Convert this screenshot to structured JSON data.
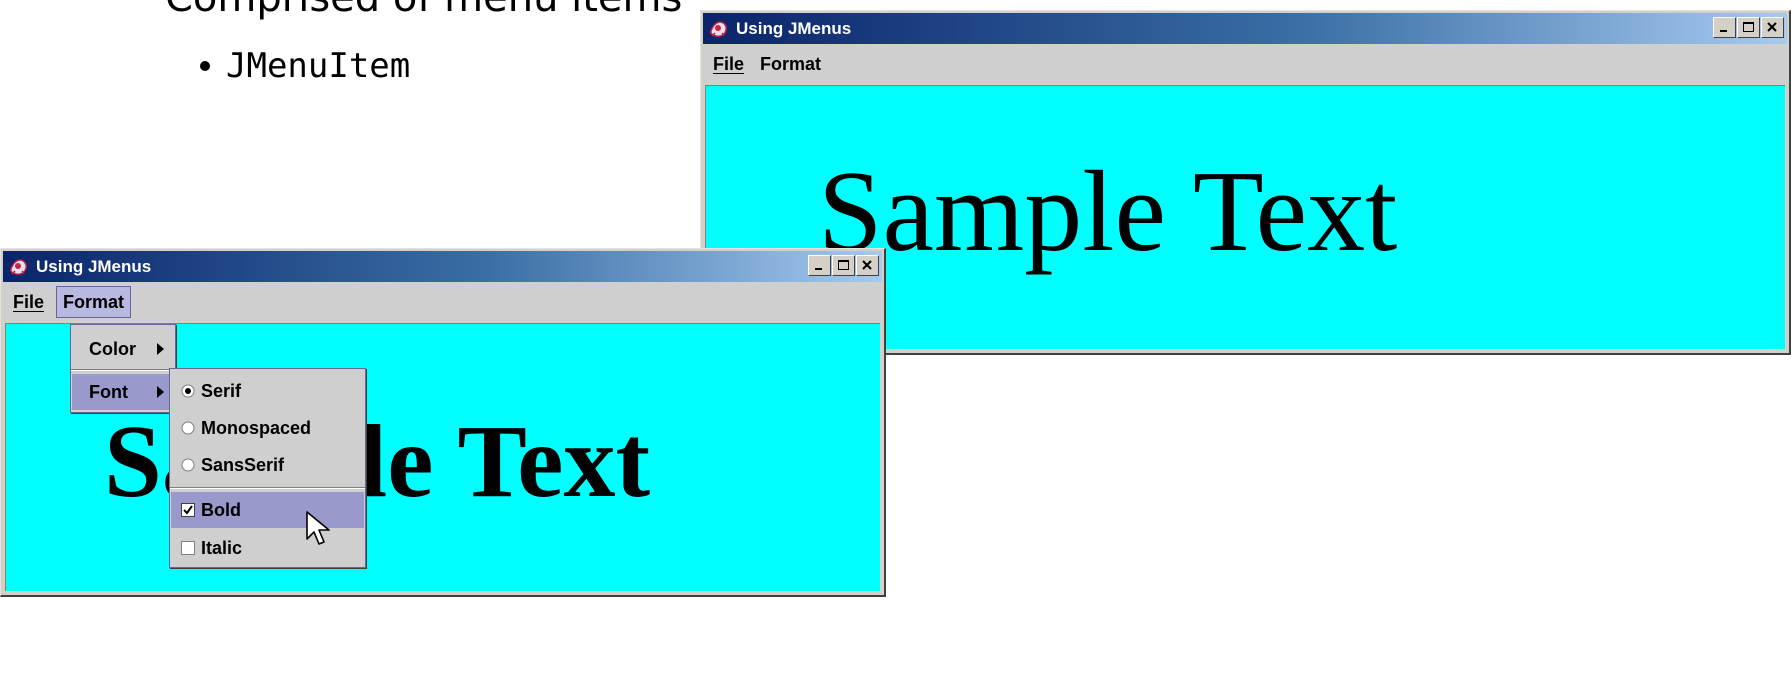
{
  "slide": {
    "heading_fragment": "Comprised of menu items",
    "bullet": "JMenuItem"
  },
  "colors": {
    "content_bg": "#00ffff",
    "titlebar_start": "#0a246a",
    "titlebar_end": "#a6caf0",
    "selected_item": "#9999cc"
  },
  "window_front": {
    "title": "Using JMenus",
    "icon": "java-duke-icon",
    "menus": [
      {
        "label": "File",
        "mnemonic": "F"
      },
      {
        "label": "Format",
        "mnemonic": "r"
      }
    ],
    "open_menu": "Format",
    "sample_text": "Sample Text",
    "format_menu": {
      "items": [
        {
          "label": "Color",
          "has_submenu": true,
          "selected": false
        },
        {
          "label": "Font",
          "has_submenu": true,
          "selected": true
        }
      ]
    },
    "font_submenu": {
      "radio_items": [
        {
          "label": "Serif",
          "checked": true
        },
        {
          "label": "Monospaced",
          "checked": false
        },
        {
          "label": "SansSerif",
          "checked": false
        }
      ],
      "check_items": [
        {
          "label": "Bold",
          "checked": true,
          "highlighted": true
        },
        {
          "label": "Italic",
          "checked": false,
          "highlighted": false
        }
      ]
    }
  },
  "window_back": {
    "title": "Using JMenus",
    "icon": "java-duke-icon",
    "menus": [
      {
        "label": "File",
        "mnemonic": "F"
      },
      {
        "label": "Format",
        "mnemonic": "r"
      }
    ],
    "sample_text": "Sample Text"
  }
}
